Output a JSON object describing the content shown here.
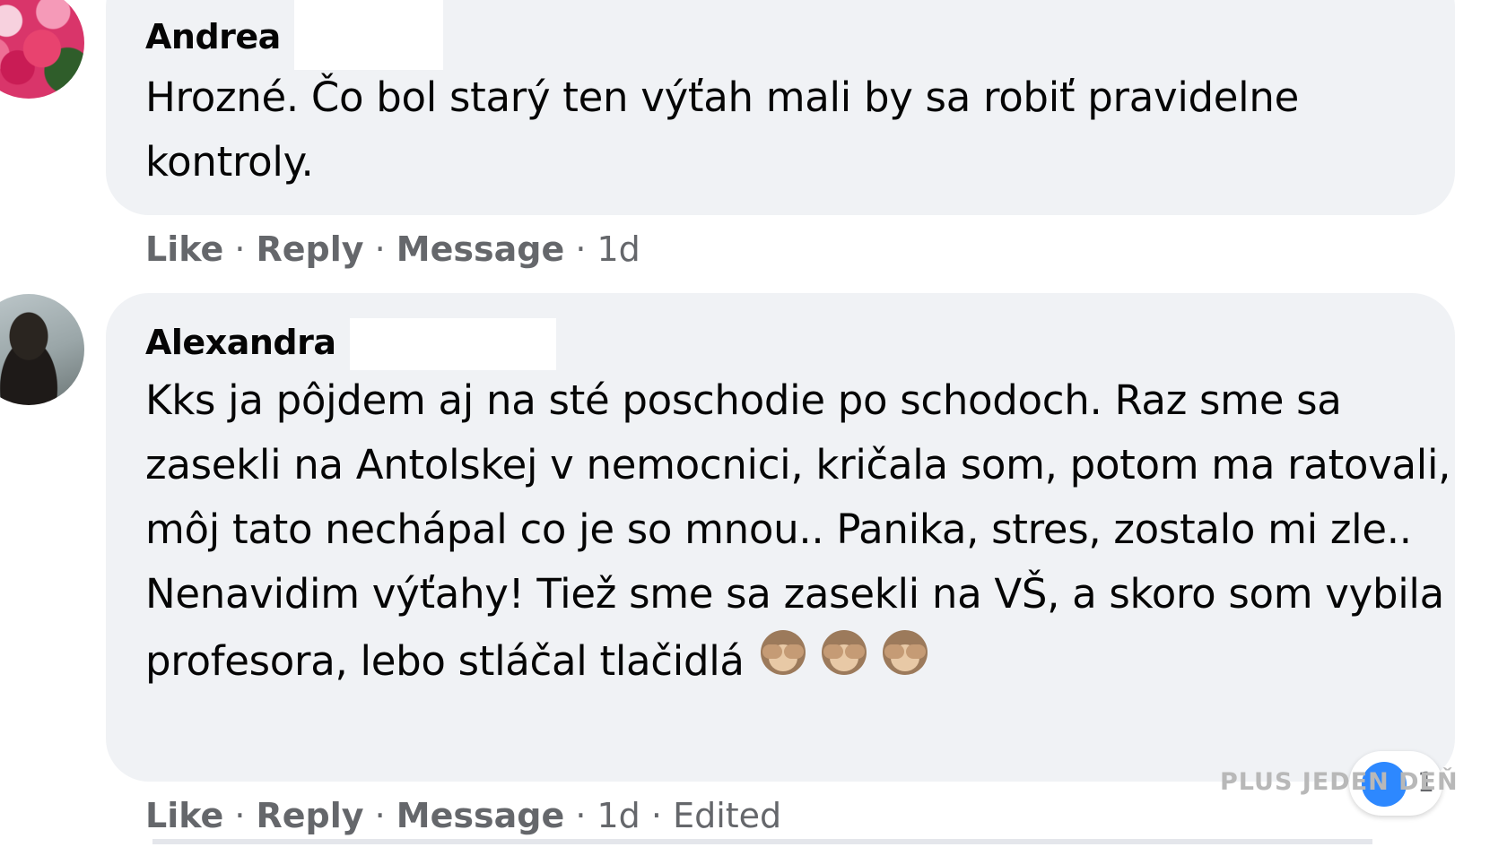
{
  "comments": [
    {
      "author": "Andrea",
      "text": "Hrozné. Čo bol starý ten výťah mali by sa robiť pravidelne kontroly.",
      "actions": {
        "like": "Like",
        "reply": "Reply",
        "message": "Message",
        "time": "1d"
      }
    },
    {
      "author": "Alexandra",
      "text": "Kks ja pôjdem aj na sté poschodie po schodoch. Raz sme sa zasekli na Antolskej v nemocnici, kričala som, potom ma ratovali, môj tato nechápal co je so mnou.. Panika, stres, zostalo mi zle.. Nenavidim výťahy! Tiež sme sa zasekli na VŠ, a skoro som vybila profesora, lebo stláčal tlačidlá",
      "emoji": [
        "see-no-evil-monkey",
        "see-no-evil-monkey",
        "see-no-evil-monkey"
      ],
      "actions": {
        "like": "Like",
        "reply": "Reply",
        "message": "Message",
        "time": "1d",
        "edited": "Edited"
      },
      "reaction_count": "1"
    }
  ],
  "watermark": "PLUS JEDEN DEŇ",
  "separator": " · ",
  "colors": {
    "bubble": "#f0f2f5",
    "text": "#050505",
    "meta": "#65676b",
    "reaction_blue": "#2d88ff"
  }
}
